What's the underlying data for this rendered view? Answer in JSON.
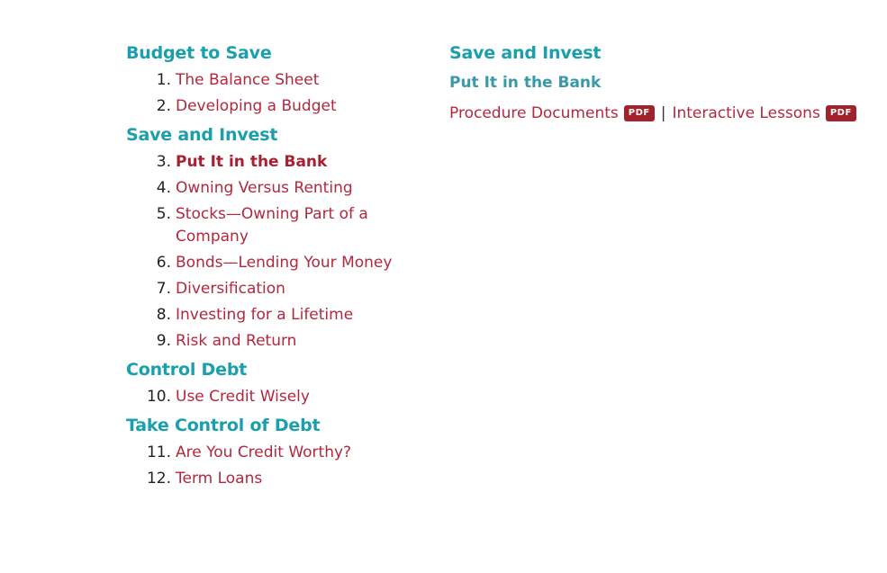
{
  "left": {
    "sections": [
      {
        "title": "Budget to Save",
        "lessons": [
          {
            "num": "1.",
            "label": "The Balance Sheet"
          },
          {
            "num": "2.",
            "label": "Developing a Budget"
          }
        ]
      },
      {
        "title": "Save and Invest",
        "lessons": [
          {
            "num": "3.",
            "label": "Put It in the Bank",
            "current": true
          },
          {
            "num": "4.",
            "label": "Owning Versus Renting"
          },
          {
            "num": "5.",
            "label": "Stocks—Owning Part of a Company"
          },
          {
            "num": "6.",
            "label": "Bonds—Lending Your Money"
          },
          {
            "num": "7.",
            "label": "Diversification"
          },
          {
            "num": "8.",
            "label": "Investing for a Lifetime"
          },
          {
            "num": "9.",
            "label": "Risk and Return"
          }
        ]
      },
      {
        "title": "Control Debt",
        "lessons": [
          {
            "num": "10.",
            "label": "Use Credit Wisely"
          }
        ]
      },
      {
        "title": "Take Control of Debt",
        "lessons": [
          {
            "num": "11.",
            "label": "Are You Credit Worthy?"
          },
          {
            "num": "12.",
            "label": "Term Loans"
          }
        ]
      }
    ]
  },
  "right": {
    "section_title": "Save and Invest",
    "lesson_title": "Put It in the Bank",
    "procedure_label": "Procedure Documents",
    "separator": "|",
    "interactive_label": "Interactive Lessons",
    "pdf_badge": "PDF"
  }
}
